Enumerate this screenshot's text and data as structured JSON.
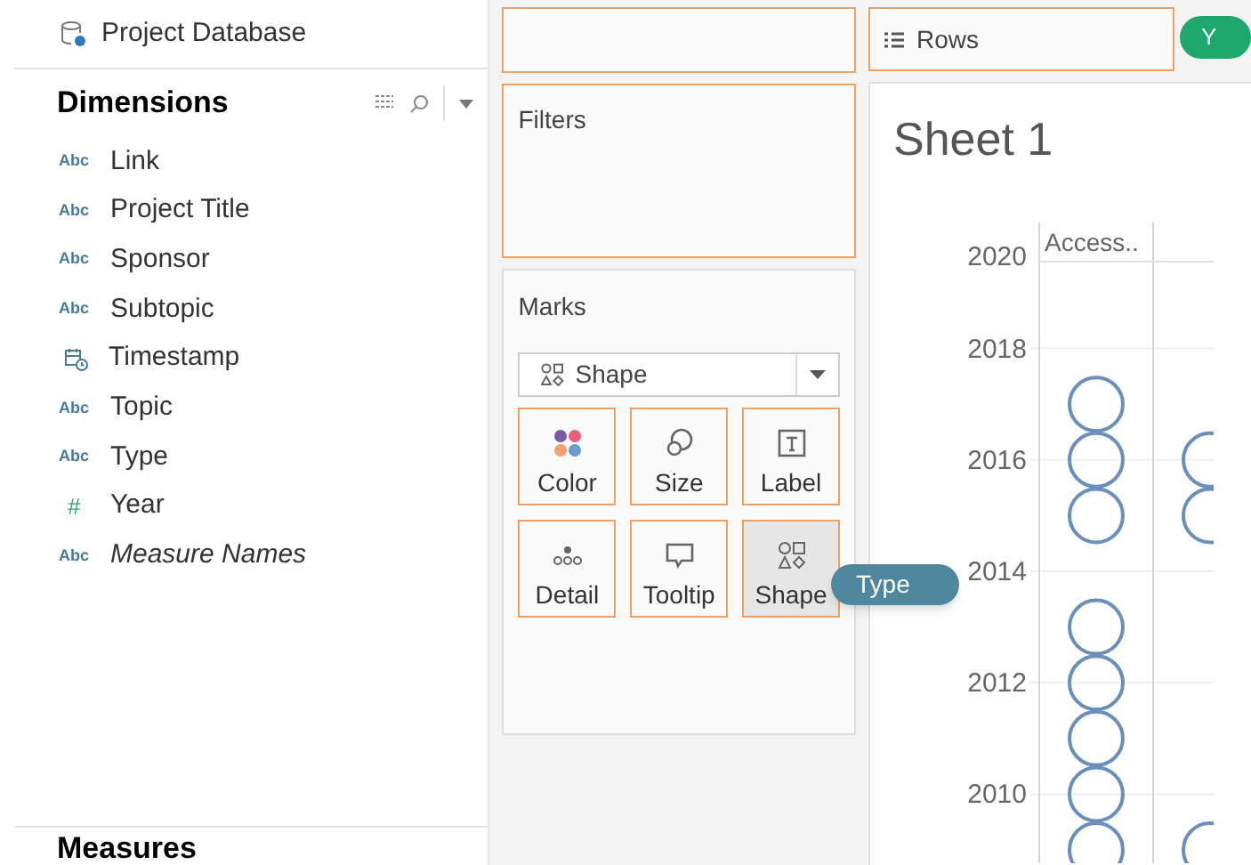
{
  "datasource": {
    "name": "Project Database"
  },
  "dimensions": {
    "title": "Dimensions",
    "fields": [
      {
        "kind": "text",
        "type_label": "Abc",
        "name": "Link",
        "italic": false
      },
      {
        "kind": "text",
        "type_label": "Abc",
        "name": "Project Title",
        "italic": false
      },
      {
        "kind": "text",
        "type_label": "Abc",
        "name": "Sponsor",
        "italic": false
      },
      {
        "kind": "text",
        "type_label": "Abc",
        "name": "Subtopic",
        "italic": false
      },
      {
        "kind": "date",
        "name": "Timestamp",
        "italic": false
      },
      {
        "kind": "text",
        "type_label": "Abc",
        "name": "Topic",
        "italic": false
      },
      {
        "kind": "text",
        "type_label": "Abc",
        "name": "Type",
        "italic": false
      },
      {
        "kind": "number",
        "type_label": "#",
        "name": "Year",
        "italic": false
      },
      {
        "kind": "text",
        "type_label": "Abc",
        "name": "Measure Names",
        "italic": true
      }
    ]
  },
  "measures": {
    "title": "Measures"
  },
  "filters": {
    "title": "Filters"
  },
  "marks": {
    "title": "Marks",
    "mark_type": "Shape",
    "cards": [
      {
        "kind": "color",
        "label": "Color"
      },
      {
        "kind": "size",
        "label": "Size"
      },
      {
        "kind": "label",
        "label": "Label"
      },
      {
        "kind": "detail",
        "label": "Detail"
      },
      {
        "kind": "tooltip",
        "label": "Tooltip"
      },
      {
        "kind": "shape",
        "label": "Shape"
      }
    ]
  },
  "drag_pill": {
    "label": "Type"
  },
  "rows_shelf": {
    "label": "Rows",
    "pill": "Y"
  },
  "sheet": {
    "title": "Sheet 1",
    "column_header": "Access..",
    "axis_labels": [
      "2020",
      "2018",
      "2016",
      "2014",
      "2012",
      "2010"
    ]
  }
}
